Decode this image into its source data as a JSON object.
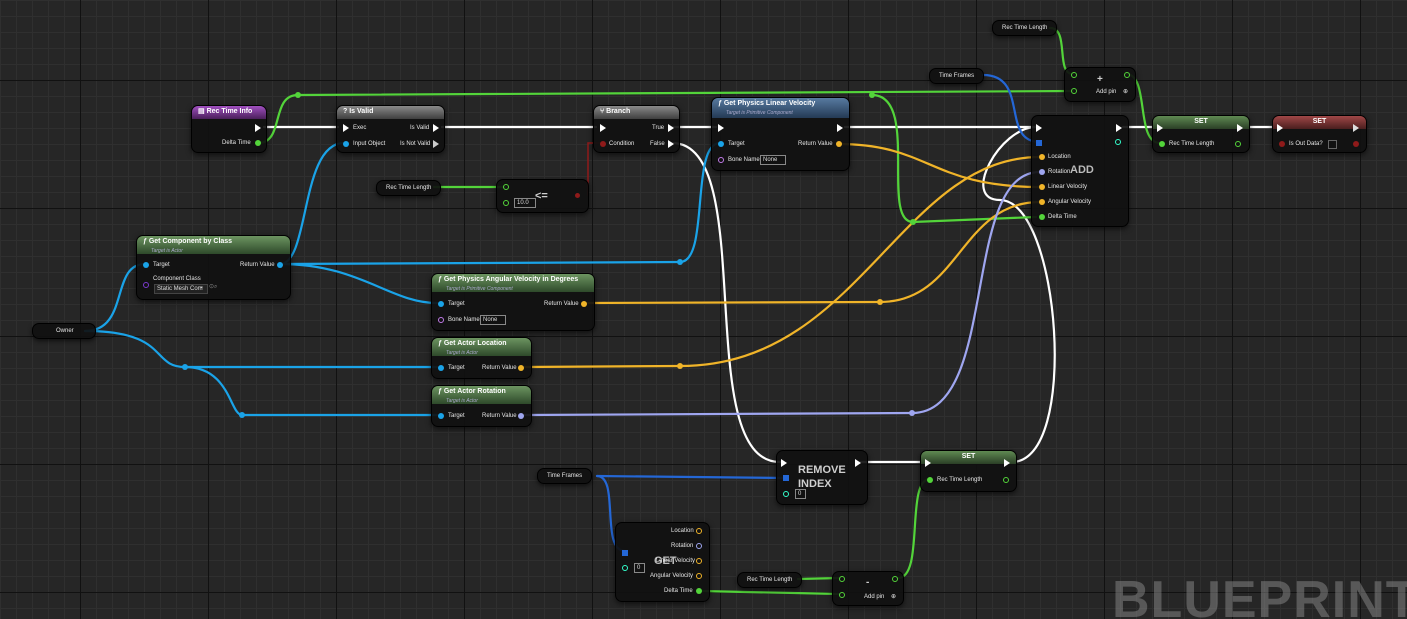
{
  "colors": {
    "exec": "#ffffff",
    "float": "#53d43a",
    "object": "#1aa3e8",
    "vector": "#f0b429",
    "rotator": "#9fa6f0",
    "bool": "#8f1a1a",
    "struct": "#2467d6",
    "name": "#c17be8"
  },
  "nodes": {
    "rec_time_info": {
      "title": "Rec Time Info",
      "delta_time": "Delta Time"
    },
    "is_valid": {
      "title": "Is Valid",
      "exec": "Exec",
      "input_object": "Input Object",
      "is_valid": "Is Valid",
      "is_not_valid": "Is Not Valid"
    },
    "branch": {
      "title": "Branch",
      "condition": "Condition",
      "true": "True",
      "false": "False"
    },
    "get_linear_velocity": {
      "title": "Get Physics Linear Velocity",
      "subtitle": "Target is Primitive Component",
      "target": "Target",
      "bone_name": "Bone Name",
      "bone_value": "None",
      "return_value": "Return Value"
    },
    "compare": {
      "op": "<=",
      "value": "10.0"
    },
    "get_component": {
      "title": "Get Component by Class",
      "subtitle": "Target is Actor",
      "target": "Target",
      "component_class": "Component Class",
      "class_value": "Static Mesh Com",
      "return_value": "Return Value"
    },
    "get_angular_velocity": {
      "title": "Get Physics Angular Velocity in Degrees",
      "subtitle": "Target is Primitive Component",
      "target": "Target",
      "bone_name": "Bone Name",
      "bone_value": "None",
      "return_value": "Return Value"
    },
    "get_actor_location": {
      "title": "Get Actor Location",
      "subtitle": "Target is Actor",
      "target": "Target",
      "return_value": "Return Value"
    },
    "get_actor_rotation": {
      "title": "Get Actor Rotation",
      "subtitle": "Target is Actor",
      "target": "Target",
      "return_value": "Return Value"
    },
    "add_array": {
      "title": "ADD",
      "location": "Location",
      "rotation": "Rotation",
      "linear_velocity": "Linear Velocity",
      "angular_velocity": "Angular Velocity",
      "delta_time": "Delta Time"
    },
    "add_pin_top": {
      "symbol": "+",
      "label": "Add pin"
    },
    "set_rec": {
      "title": "SET",
      "pin": "Rec Time Length"
    },
    "set_out": {
      "title": "SET",
      "pin": "Is Out Data?"
    },
    "remove_index": {
      "title": "REMOVE INDEX",
      "index": "0"
    },
    "set_rec2": {
      "title": "SET",
      "pin": "Rec Time Length"
    },
    "get_array": {
      "title": "GET",
      "index": "0",
      "location": "Location",
      "rotation": "Rotation",
      "linear_velocity": "Linear Velocity",
      "angular_velocity": "Angular Velocity",
      "delta_time": "Delta Time"
    },
    "subtract": {
      "symbol": "-",
      "label": "Add pin"
    }
  },
  "vars": {
    "rec_time_length": "Rec Time Length",
    "time_frames": "Time Frames",
    "owner": "Owner"
  },
  "watermark": "BLUEPRINT"
}
